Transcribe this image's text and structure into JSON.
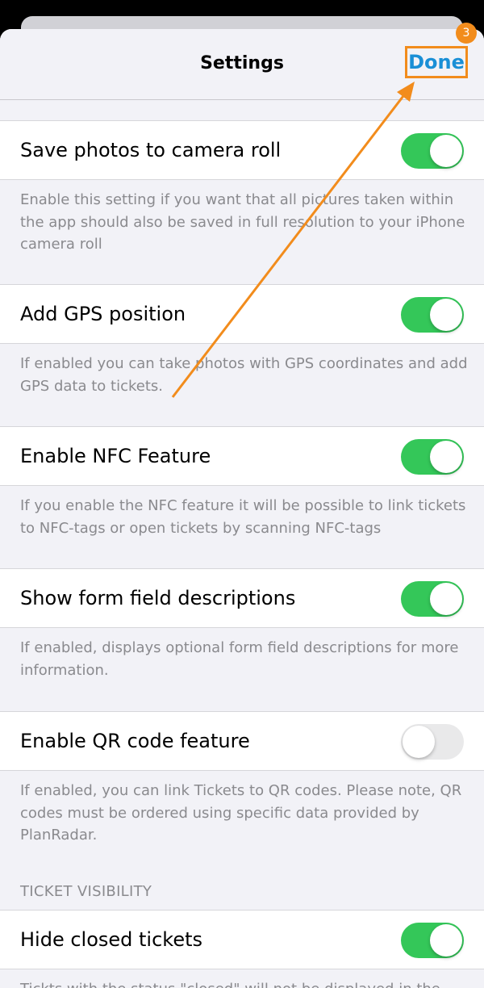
{
  "header": {
    "title": "Settings",
    "done_label": "Done",
    "step_badge": "3"
  },
  "settings": [
    {
      "label": "Save photos to camera roll",
      "enabled": true,
      "description": "Enable this setting if you want that all pictures taken within the app should also be saved in full resolution to your iPhone camera roll"
    },
    {
      "label": "Add GPS position",
      "enabled": true,
      "description": "If enabled you can take photos with GPS coordinates and add GPS data to tickets."
    },
    {
      "label": "Enable NFC Feature",
      "enabled": true,
      "description": "If you enable the NFC feature it will be possible to link tickets to NFC-tags or open tickets by scanning NFC-tags"
    },
    {
      "label": "Show form field descriptions",
      "enabled": true,
      "description": "If enabled, displays optional form field descriptions for more information."
    },
    {
      "label": "Enable QR code feature",
      "enabled": false,
      "description": "If enabled, you can link Tickets to QR codes. Please note, QR codes must be ordered using specific data provided by PlanRadar."
    }
  ],
  "ticket_visibility": {
    "header": "TICKET VISIBILITY",
    "setting": {
      "label": "Hide closed tickets",
      "enabled": true,
      "description": "Tickts with the status \"closed\" will not be displayed in the"
    }
  },
  "colors": {
    "accent": "#1a8fd6",
    "annotation": "#f28c1c",
    "toggle_on": "#34c759",
    "toggle_off": "#e9e9ea"
  }
}
